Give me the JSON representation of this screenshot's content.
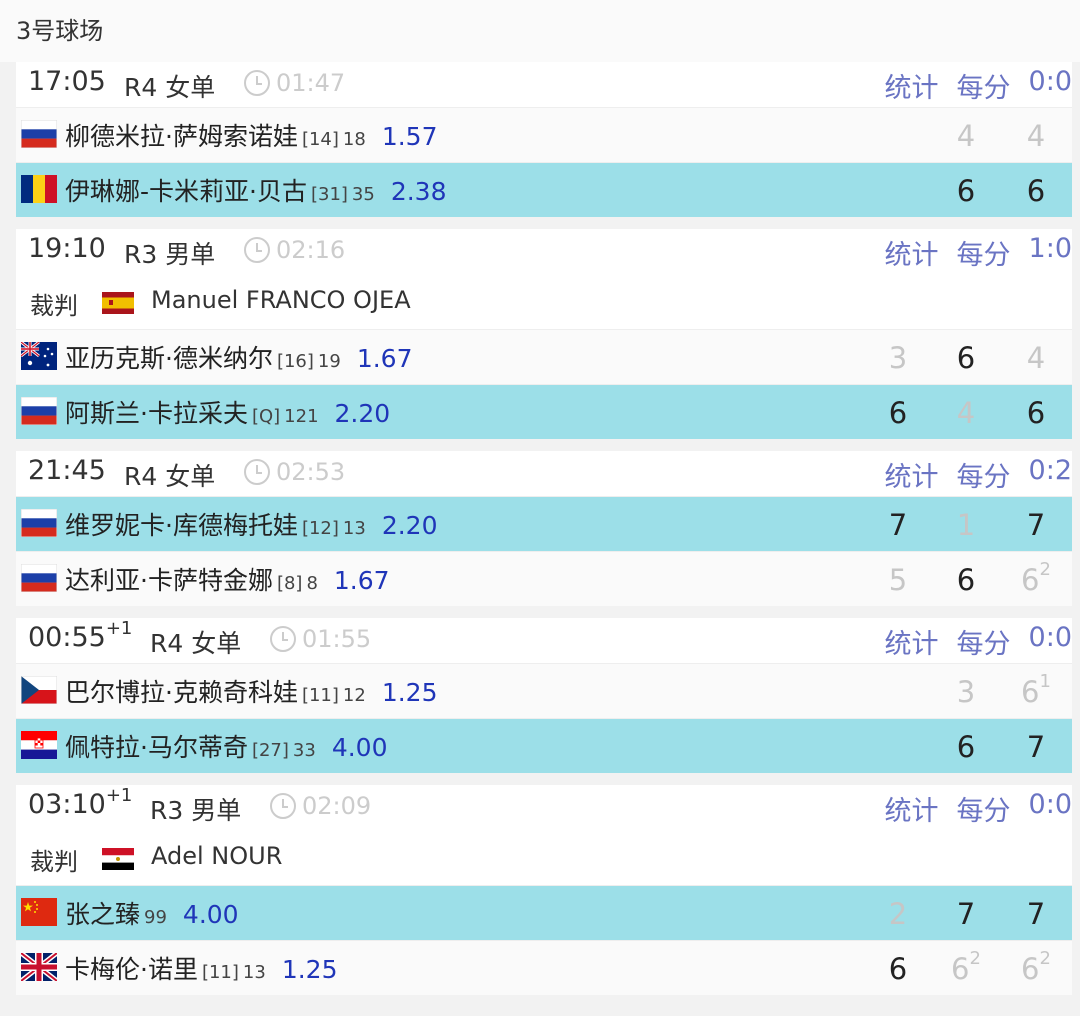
{
  "court": "3号球场",
  "labels": {
    "stats": "统计",
    "points": "每分",
    "referee": "裁判"
  },
  "matches": [
    {
      "time": "17:05",
      "time_sup": "",
      "round": "R4 女单",
      "duration": "01:47",
      "score": "0:0",
      "referee": null,
      "players": [
        {
          "name": "柳德米拉·萨姆索诺娃",
          "seed": "[14]",
          "rank": "18",
          "odds": "1.57",
          "flag": "russia",
          "winner": false,
          "sets": [
            {
              "v": "",
              "t": "",
              "lose": true
            },
            {
              "v": "4",
              "t": "",
              "lose": true
            },
            {
              "v": "4",
              "t": "",
              "lose": true
            }
          ]
        },
        {
          "name": "伊琳娜-卡米莉亚·贝古",
          "seed": "[31]",
          "rank": "35",
          "odds": "2.38",
          "flag": "romania",
          "winner": true,
          "sets": [
            {
              "v": "",
              "t": "",
              "lose": false
            },
            {
              "v": "6",
              "t": "",
              "lose": false
            },
            {
              "v": "6",
              "t": "",
              "lose": false
            }
          ]
        }
      ]
    },
    {
      "time": "19:10",
      "time_sup": "",
      "round": "R3 男单",
      "duration": "02:16",
      "score": "1:0",
      "referee": {
        "name": "Manuel FRANCO OJEA",
        "flag": "spain"
      },
      "players": [
        {
          "name": "亚历克斯·德米纳尔",
          "seed": "[16]",
          "rank": "19",
          "odds": "1.67",
          "flag": "australia",
          "winner": false,
          "sets": [
            {
              "v": "3",
              "t": "",
              "lose": true
            },
            {
              "v": "6",
              "t": "",
              "lose": false
            },
            {
              "v": "4",
              "t": "",
              "lose": true
            }
          ]
        },
        {
          "name": "阿斯兰·卡拉采夫",
          "seed": "[Q]",
          "rank": "121",
          "odds": "2.20",
          "flag": "russia",
          "winner": true,
          "sets": [
            {
              "v": "6",
              "t": "",
              "lose": false
            },
            {
              "v": "4",
              "t": "",
              "lose": true
            },
            {
              "v": "6",
              "t": "",
              "lose": false
            }
          ]
        }
      ]
    },
    {
      "time": "21:45",
      "time_sup": "",
      "round": "R4 女单",
      "duration": "02:53",
      "score": "0:2",
      "referee": null,
      "players": [
        {
          "name": "维罗妮卡·库德梅托娃",
          "seed": "[12]",
          "rank": "13",
          "odds": "2.20",
          "flag": "russia",
          "winner": true,
          "sets": [
            {
              "v": "7",
              "t": "",
              "lose": false
            },
            {
              "v": "1",
              "t": "",
              "lose": true
            },
            {
              "v": "7",
              "t": "",
              "lose": false
            }
          ]
        },
        {
          "name": "达利亚·卡萨特金娜",
          "seed": "[8]",
          "rank": "8",
          "odds": "1.67",
          "flag": "russia",
          "winner": false,
          "sets": [
            {
              "v": "5",
              "t": "",
              "lose": true
            },
            {
              "v": "6",
              "t": "",
              "lose": false
            },
            {
              "v": "6",
              "t": "2",
              "lose": true
            }
          ]
        }
      ]
    },
    {
      "time": "00:55",
      "time_sup": "+1",
      "round": "R4 女单",
      "duration": "01:55",
      "score": "0:0",
      "referee": null,
      "players": [
        {
          "name": "巴尔博拉·克赖奇科娃",
          "seed": "[11]",
          "rank": "12",
          "odds": "1.25",
          "flag": "czech",
          "winner": false,
          "sets": [
            {
              "v": "",
              "t": "",
              "lose": true
            },
            {
              "v": "3",
              "t": "",
              "lose": true
            },
            {
              "v": "6",
              "t": "1",
              "lose": true
            }
          ]
        },
        {
          "name": "佩特拉·马尔蒂奇",
          "seed": "[27]",
          "rank": "33",
          "odds": "4.00",
          "flag": "croatia",
          "winner": true,
          "sets": [
            {
              "v": "",
              "t": "",
              "lose": false
            },
            {
              "v": "6",
              "t": "",
              "lose": false
            },
            {
              "v": "7",
              "t": "",
              "lose": false
            }
          ]
        }
      ]
    },
    {
      "time": "03:10",
      "time_sup": "+1",
      "round": "R3 男单",
      "duration": "02:09",
      "score": "0:0",
      "referee": {
        "name": "Adel NOUR",
        "flag": "egypt"
      },
      "players": [
        {
          "name": "张之臻",
          "seed": "",
          "rank": "99",
          "odds": "4.00",
          "flag": "china",
          "winner": true,
          "sets": [
            {
              "v": "2",
              "t": "",
              "lose": true
            },
            {
              "v": "7",
              "t": "",
              "lose": false
            },
            {
              "v": "7",
              "t": "",
              "lose": false
            }
          ]
        },
        {
          "name": "卡梅伦·诺里",
          "seed": "[11]",
          "rank": "13",
          "odds": "1.25",
          "flag": "uk",
          "winner": false,
          "sets": [
            {
              "v": "6",
              "t": "",
              "lose": false
            },
            {
              "v": "6",
              "t": "2",
              "lose": true
            },
            {
              "v": "6",
              "t": "2",
              "lose": true
            }
          ]
        }
      ]
    }
  ]
}
